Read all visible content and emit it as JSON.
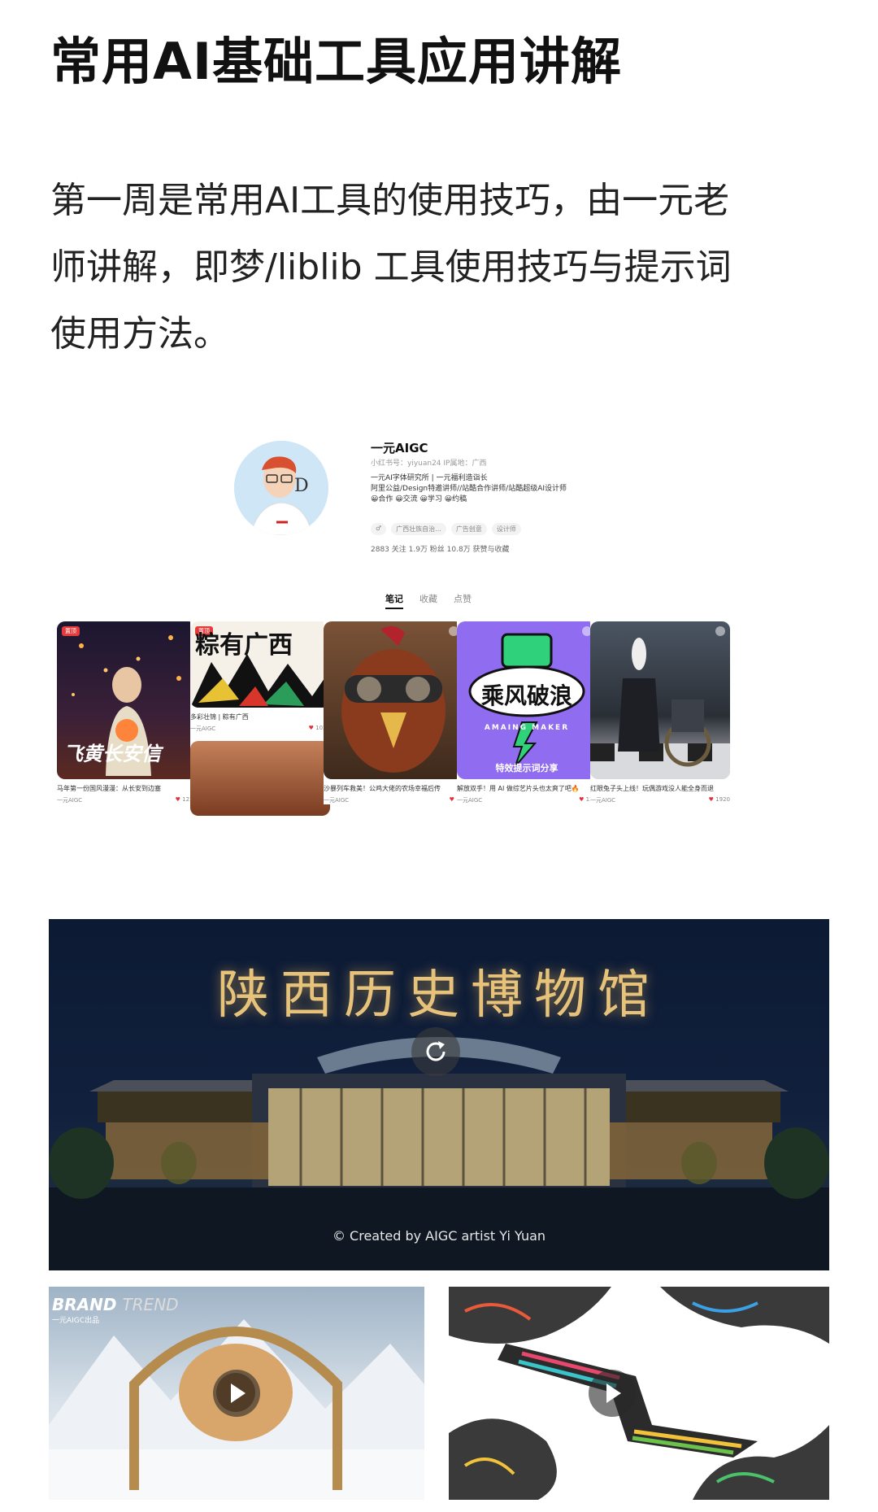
{
  "article": {
    "title": "常用AI基础工具应用讲解",
    "intro_lines": [
      "第一周是常用AI工具的使用技巧，由一元老",
      "师讲解，即梦/liblib 工具使用技巧与提示词",
      "使用方法。"
    ]
  },
  "profile": {
    "name": "一元AIGC",
    "meta": "小红书号：yiyuan24   IP属地：广西",
    "desc_lines": [
      "一元AI字体研究所 | 一元福利造诣长",
      "阿里公益/Design特邀讲师//站酷合作讲师/站酷超级AI设计师",
      "😀合作 😀交流 😀学习 😀约稿"
    ],
    "tags": [
      "♂",
      "广西壮族自治...",
      "广告创意",
      "设计师"
    ],
    "stats": "2883 关注   1.9万 粉丝   10.8万 获赞与收藏",
    "tabs": [
      "笔记",
      "收藏",
      "点赞"
    ],
    "cards": [
      {
        "caption": "马年第一份国风漫漫：从长安到边塞",
        "author": "一元AIGC",
        "likes": "1228",
        "badge": "置顶",
        "art_text": "飞黄长安信"
      },
      {
        "caption": "多彩壮锦 | 粽有广西",
        "author": "一元AIGC",
        "likes": "1028",
        "badge": "置顶",
        "art_text": "粽有广西"
      },
      {
        "caption": "沙暴列车救美！公鸡大佬的农场幸福后传",
        "author": "一元AIGC",
        "likes": "17",
        "badge": ""
      },
      {
        "caption": "解放双手！用 AI 做综艺片头也太爽了吧🔥",
        "author": "一元AIGC",
        "likes": "129",
        "badge": "",
        "art_text": "乘风破浪",
        "art_sub": "特效提示词分享",
        "art_ring": "AMAING  MAKER"
      },
      {
        "caption": "红眼兔子头上线！玩偶游戏没人能全身而退",
        "author": "一元AIGC",
        "likes": "1920",
        "badge": ""
      }
    ]
  },
  "museum": {
    "title": "陕西历史博物馆",
    "credit": "© Created by AIGC artist Yi Yuan"
  },
  "videos": {
    "brand_bold": "BRAND",
    "brand_light": "TREND",
    "brand_sub": "一元AIGC出品"
  }
}
